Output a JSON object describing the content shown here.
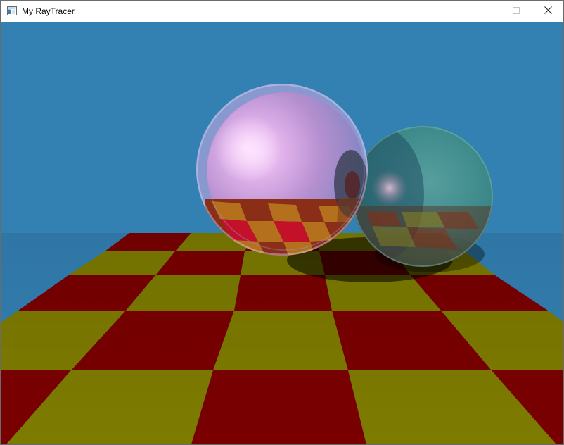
{
  "window": {
    "title": "My RayTracer",
    "icon": "app-window-icon",
    "controls": {
      "minimize_icon": "minimize-icon",
      "maximize_icon": "maximize-icon",
      "close_icon": "close-icon"
    }
  },
  "scene": {
    "colors": {
      "sky": "#3380b3",
      "floor_red": "#7a0000",
      "floor_yellow": "#7d7b00",
      "pink_sphere": "#e6b8e8",
      "teal_sphere": "#3e8a80"
    }
  }
}
